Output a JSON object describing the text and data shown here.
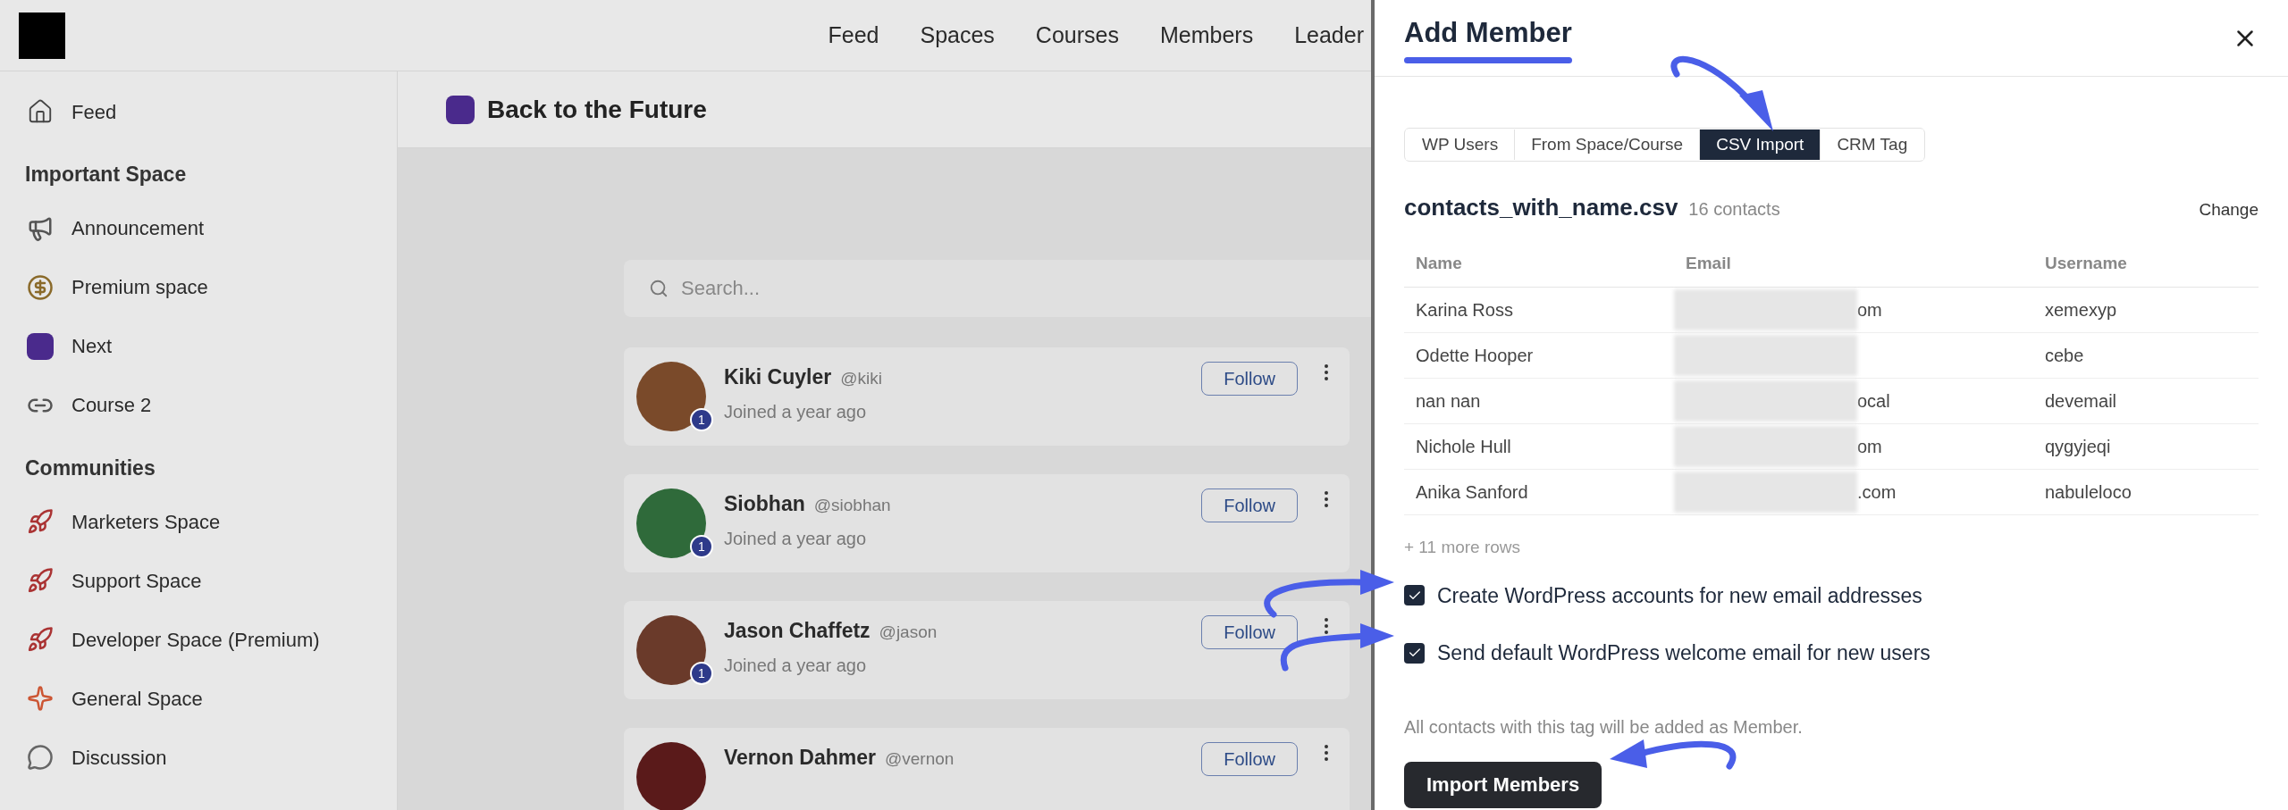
{
  "header": {
    "nav": [
      {
        "label": "Feed"
      },
      {
        "label": "Spaces"
      },
      {
        "label": "Courses"
      },
      {
        "label": "Members"
      },
      {
        "label": "Leader"
      }
    ]
  },
  "sidebar": {
    "items": [
      {
        "kind": "home",
        "label": "Feed"
      }
    ],
    "sections": [
      {
        "title": "Important Space",
        "items": [
          {
            "kind": "megaphone",
            "label": "Announcement"
          },
          {
            "kind": "money",
            "label": "Premium space"
          },
          {
            "kind": "space",
            "label": "Next",
            "color": "#4a2a8c"
          },
          {
            "kind": "link",
            "label": "Course 2"
          }
        ]
      },
      {
        "title": "Communities",
        "items": [
          {
            "kind": "rocket",
            "label": "Marketers Space"
          },
          {
            "kind": "rocket",
            "label": "Support Space"
          },
          {
            "kind": "rocket",
            "label": "Developer Space (Premium)"
          },
          {
            "kind": "burst",
            "label": "General Space"
          },
          {
            "kind": "chat",
            "label": "Discussion"
          }
        ]
      }
    ]
  },
  "space": {
    "title": "Back to the Future",
    "color": "#4a2a8c"
  },
  "search": {
    "placeholder": "Search..."
  },
  "members": [
    {
      "name": "Kiki Cuyler",
      "handle": "@kiki",
      "joined": "Joined a year ago",
      "badge": "1",
      "button": "Follow"
    },
    {
      "name": "Siobhan",
      "handle": "@siobhan",
      "joined": "Joined a year ago",
      "badge": "1",
      "button": "Follow"
    },
    {
      "name": "Jason Chaffetz",
      "handle": "@jason",
      "joined": "Joined a year ago",
      "badge": "1",
      "button": "Follow"
    },
    {
      "name": "Vernon Dahmer",
      "handle": "@vernon",
      "button": "Follow"
    }
  ],
  "panel": {
    "title": "Add Member",
    "tabs": [
      {
        "label": "WP Users",
        "selected": false
      },
      {
        "label": "From Space/Course",
        "selected": false
      },
      {
        "label": "CSV Import",
        "selected": true
      },
      {
        "label": "CRM Tag",
        "selected": false
      }
    ],
    "file": {
      "name": "contacts_with_name.csv",
      "count": "16 contacts",
      "action": "Change"
    },
    "table": {
      "columns": [
        "Name",
        "Email",
        "Username"
      ],
      "rows": [
        {
          "name": "Karina Ross",
          "email_tail": "om",
          "username": "xemexyp"
        },
        {
          "name": "Odette Hooper",
          "username": "cebe"
        },
        {
          "name": "nan nan",
          "email_tail": "ocal",
          "username": "devemail"
        },
        {
          "name": "Nichole Hull",
          "email_tail": "om",
          "username": "qygyjeqi"
        },
        {
          "name": "Anika Sanford",
          "email_tail": ".com",
          "username": "nabuleloco"
        }
      ],
      "more": "+ 11 more rows"
    },
    "options": [
      {
        "label": "Create WordPress accounts for new email addresses",
        "checked": true
      },
      {
        "label": "Send default WordPress welcome email for new users",
        "checked": true
      }
    ],
    "note": "All contacts with this tag will be added as Member.",
    "button": "Import Members"
  }
}
